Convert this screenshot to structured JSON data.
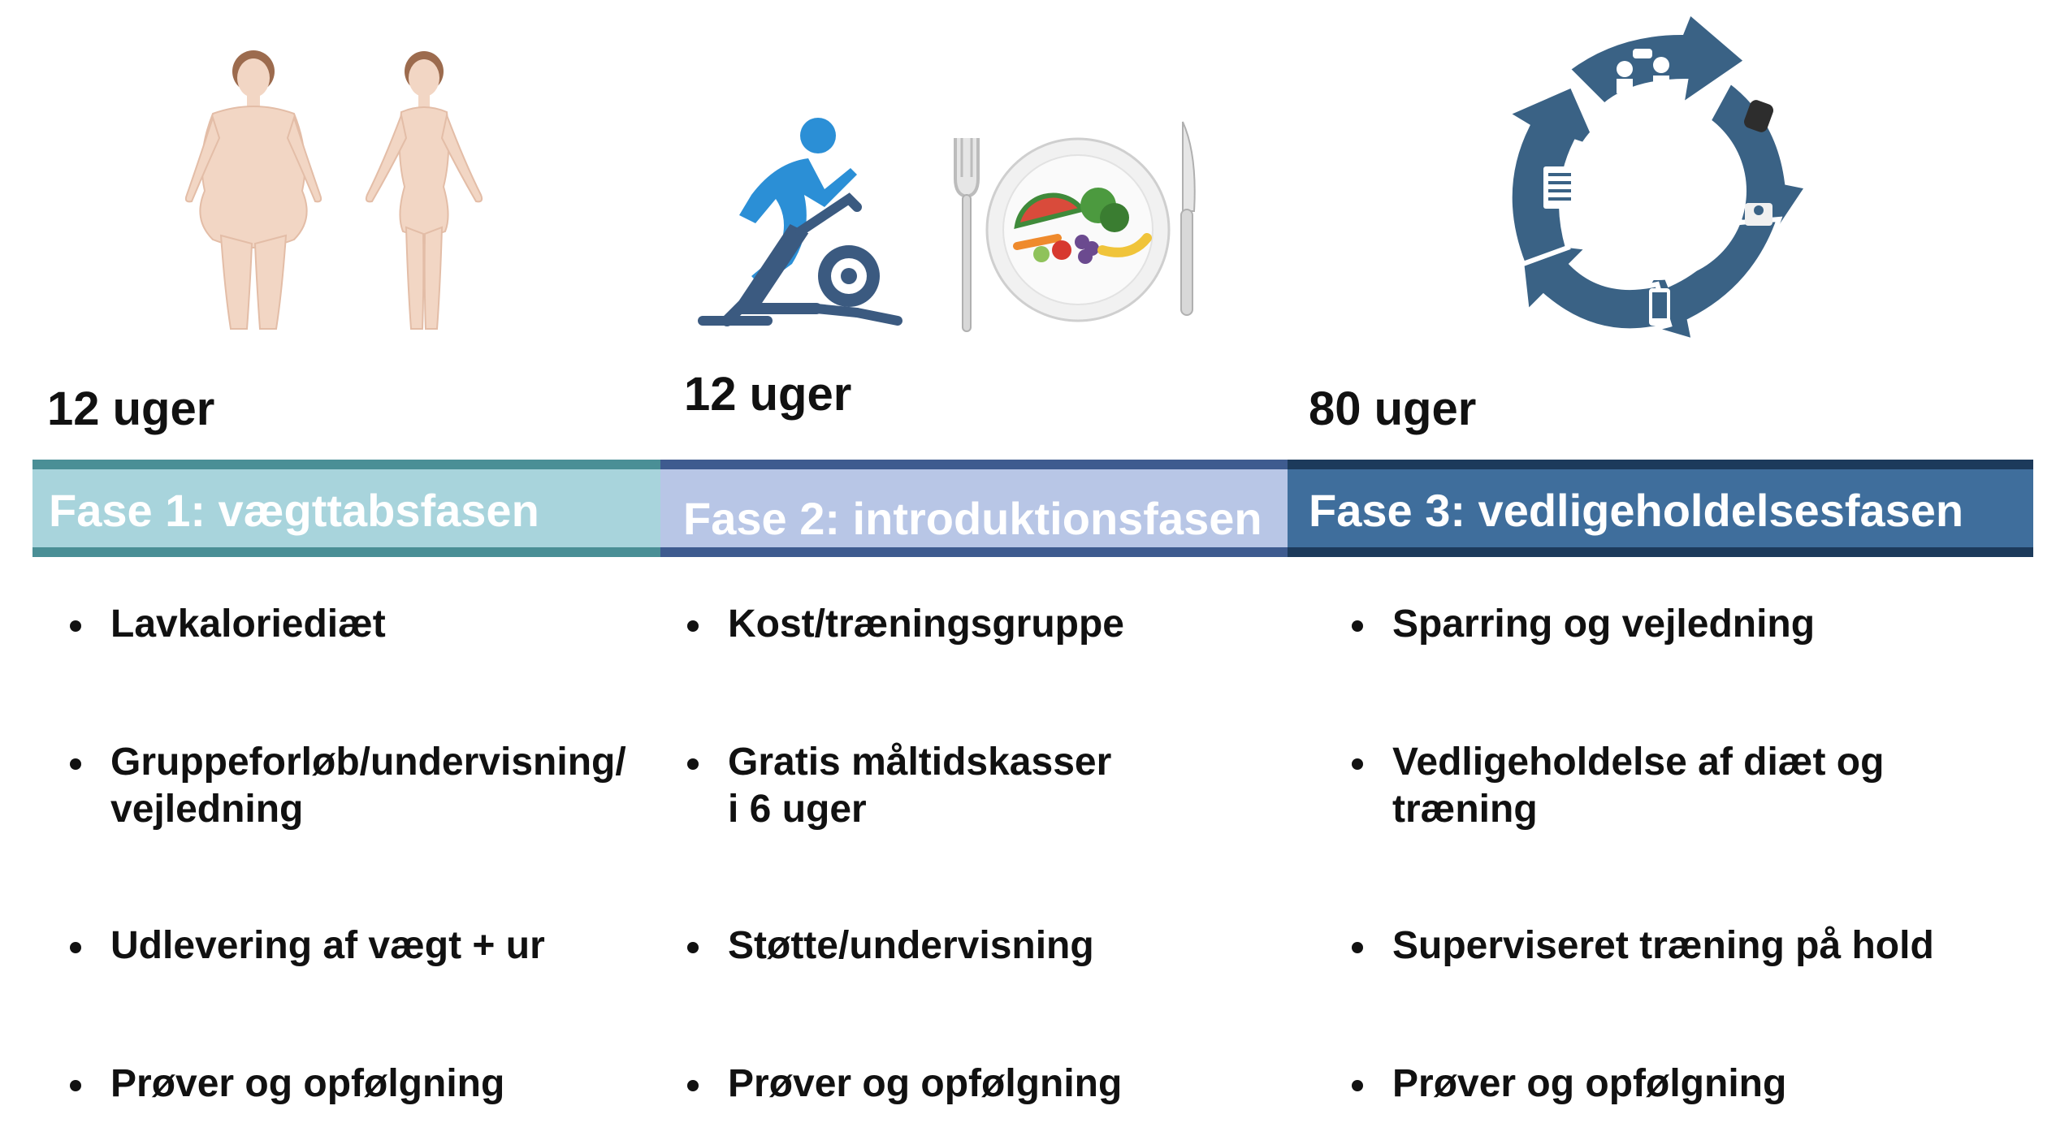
{
  "phases": [
    {
      "weeks": "12 uger",
      "label": "Fase 1: vægttabsfasen",
      "color": "#a8d4dc",
      "border_color": "#4a8f96",
      "items": [
        {
          "lines": [
            "Lavkaloriediæt"
          ]
        },
        {
          "lines": [
            "Gruppeforløb/undervisning/",
            "vejledning"
          ]
        },
        {
          "lines": [
            "Udlevering af vægt + ur"
          ]
        },
        {
          "lines": [
            "Prøver og opfølgning"
          ]
        }
      ]
    },
    {
      "weeks": "12 uger",
      "label": "Fase 2: introduktionsfasen",
      "color": "#b8c6e6",
      "border_color": "#3e5b8f",
      "items": [
        {
          "lines": [
            "Kost/træningsgruppe"
          ]
        },
        {
          "lines": [
            "Gratis måltidskasser",
            "i 6 uger"
          ]
        },
        {
          "lines": [
            "Støtte/undervisning"
          ]
        },
        {
          "lines": [
            "Prøver og opfølgning"
          ]
        }
      ]
    },
    {
      "weeks": "80 uger",
      "label": "Fase 3: vedligeholdelsesfasen",
      "color": "#3f6e9c",
      "border_color": "#1c3a5b",
      "items": [
        {
          "lines": [
            "Sparring og vejledning"
          ]
        },
        {
          "lines": [
            "Vedligeholdelse af diæt og",
            "træning"
          ]
        },
        {
          "lines": [
            "Superviseret træning på hold"
          ]
        },
        {
          "lines": [
            "Prøver og opfølgning"
          ]
        }
      ]
    }
  ],
  "icons": {
    "phase1": [
      "body-before-icon",
      "body-after-icon"
    ],
    "phase2": [
      "exercise-bike-icon",
      "fork-icon",
      "plate-of-vegetables-icon",
      "knife-icon"
    ],
    "phase3": [
      "cycle-arrows-icon",
      "consultation-icon",
      "smartwatch-icon",
      "scale-icon",
      "smartphone-icon",
      "checklist-icon"
    ]
  },
  "colors": {
    "skin": "#f2d6c4",
    "hair": "#9c6b4e",
    "cyclist": "#2b8fd6",
    "bike": "#3b5a80",
    "cycle": "#3a6285"
  }
}
